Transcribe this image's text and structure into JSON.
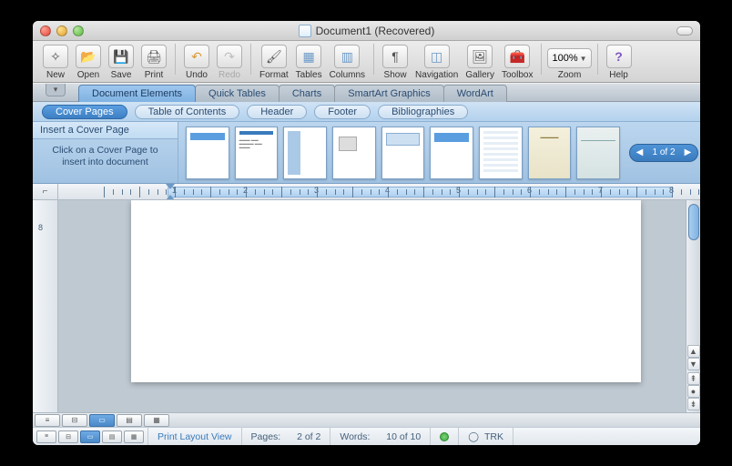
{
  "window": {
    "title": "Document1 (Recovered)"
  },
  "toolbar": {
    "new": "New",
    "open": "Open",
    "save": "Save",
    "print": "Print",
    "undo": "Undo",
    "redo": "Redo",
    "format": "Format",
    "tables": "Tables",
    "columns": "Columns",
    "show": "Show",
    "navigation": "Navigation",
    "gallery": "Gallery",
    "toolbox": "Toolbox",
    "zoom_label": "Zoom",
    "zoom_value": "100%",
    "help": "Help"
  },
  "ribbon": {
    "tabs": [
      "Document Elements",
      "Quick Tables",
      "Charts",
      "SmartArt Graphics",
      "WordArt"
    ],
    "active": 0
  },
  "subtabs": {
    "items": [
      "Cover Pages",
      "Table of Contents",
      "Header",
      "Footer",
      "Bibliographies"
    ],
    "active": 0
  },
  "gallery": {
    "command": "Insert a Cover Page",
    "hint": "Click on a Cover Page to insert into document",
    "pager": "1 of 2"
  },
  "status": {
    "view": "Print Layout View",
    "pages_label": "Pages:",
    "pages_value": "2 of 2",
    "words_label": "Words:",
    "words_value": "10 of 10",
    "trk": "TRK"
  }
}
